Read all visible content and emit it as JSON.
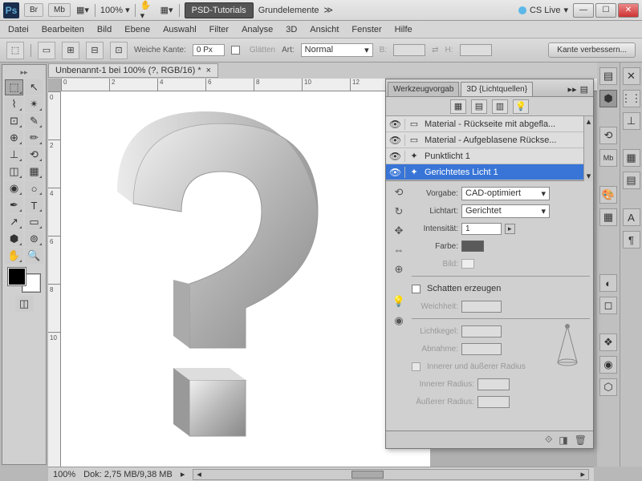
{
  "titlebar": {
    "br": "Br",
    "mb": "Mb",
    "zoom": "100%",
    "psd_tutorials": "PSD-Tutorials",
    "grundelemente": "Grundelemente",
    "cslive": "CS Live"
  },
  "menu": {
    "datei": "Datei",
    "bearbeiten": "Bearbeiten",
    "bild": "Bild",
    "ebene": "Ebene",
    "auswahl": "Auswahl",
    "filter": "Filter",
    "analyse": "Analyse",
    "d3": "3D",
    "ansicht": "Ansicht",
    "fenster": "Fenster",
    "hilfe": "Hilfe"
  },
  "options": {
    "weiche_kante": "Weiche Kante:",
    "weiche_kante_val": "0 Px",
    "glaetten": "Glätten",
    "art": "Art:",
    "art_val": "Normal",
    "b": "B:",
    "h": "H:",
    "kante": "Kante verbessern..."
  },
  "doc": {
    "tab": "Unbenannt-1 bei 100% (?, RGB/16) *"
  },
  "ruler_h": [
    "0",
    "2",
    "4",
    "6",
    "8",
    "10",
    "12"
  ],
  "ruler_v": [
    "0",
    "2",
    "4",
    "6",
    "8",
    "10"
  ],
  "panel": {
    "tab_werkzeug": "Werkzeugvorgab",
    "tab_3d": "3D {Lichtquellen}",
    "layers": [
      {
        "name": "Material - Rückseite mit abgefla...",
        "sel": false,
        "icon": "▭"
      },
      {
        "name": "Material - Aufgeblasene Rückse...",
        "sel": false,
        "icon": "▭"
      },
      {
        "name": "Punktlicht 1",
        "sel": false,
        "icon": "✦"
      },
      {
        "name": "Gerichtetes Licht 1",
        "sel": true,
        "icon": "✦"
      }
    ],
    "vorgabe": "Vorgabe:",
    "vorgabe_val": "CAD-optimiert",
    "lichtart": "Lichtart:",
    "lichtart_val": "Gerichtet",
    "intensitaet": "Intensität:",
    "intensitaet_val": "1",
    "farbe": "Farbe:",
    "bild": "Bild:",
    "schatten": "Schatten erzeugen",
    "weichheit": "Weichheit:",
    "lichtkegel": "Lichtkegel:",
    "abnahme": "Abnahme:",
    "radius_chk": "Innerer und äußerer Radius",
    "inner_radius": "Innerer Radius:",
    "outer_radius": "Äußerer Radius:"
  },
  "status": {
    "zoom": "100%",
    "dok": "Dok: 2,75 MB/9,38 MB"
  }
}
